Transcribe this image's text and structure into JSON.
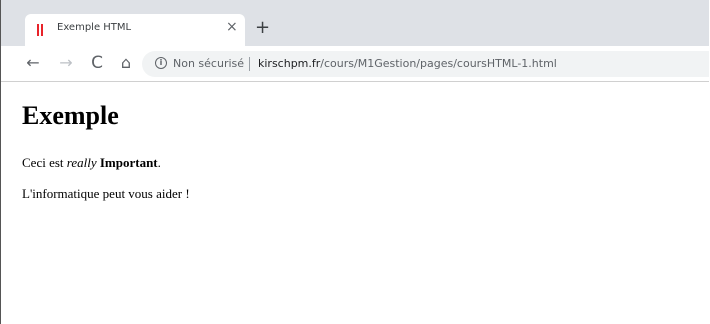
{
  "tab": {
    "title": "Exemple HTML",
    "close_symbol": "×",
    "favicon": "html-favicon-icon"
  },
  "new_tab_symbol": "+",
  "toolbar": {
    "back_symbol": "←",
    "forward_symbol": "→",
    "reload_symbol": "C",
    "home_symbol": "⌂",
    "info_symbol": "i",
    "security_label": "Non sécurisé",
    "url_domain": "kirschpm.fr",
    "url_path": "/cours/M1Gestion/pages/coursHTML-1.html"
  },
  "page": {
    "heading": "Exemple",
    "p1_before": "Ceci est ",
    "p1_italic": "really",
    "p1_bold": "Important",
    "p1_after": ".",
    "p2": "L'informatique peut vous aider !"
  },
  "colors": {
    "tab_strip": "#dee1e6",
    "favicon": "#e8232a",
    "omnibox": "#f1f3f4"
  }
}
